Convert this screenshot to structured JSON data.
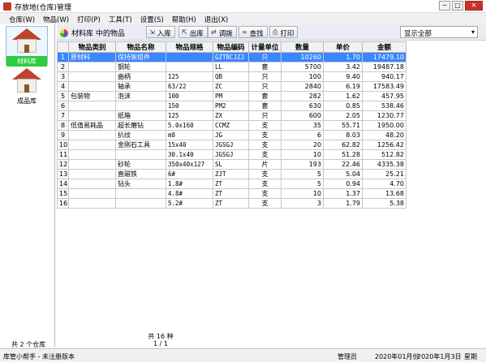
{
  "window": {
    "title": "存放地(仓库)管理",
    "controls": [
      "─",
      "□",
      "✕"
    ]
  },
  "menu": [
    "仓库(W)",
    "物品(W)",
    "打印(P)",
    "工具(T)",
    "设置(S)",
    "帮助(H)",
    "退出(X)"
  ],
  "sidebar": {
    "items": [
      {
        "label": "材料库",
        "active": true
      },
      {
        "label": "成品库",
        "active": false
      }
    ],
    "count_text": "共 2 个仓库"
  },
  "toolbar": {
    "title": "材料库 中的物品",
    "buttons": [
      {
        "label": "入库",
        "icon": "import-icon"
      },
      {
        "label": "出库",
        "icon": "export-icon"
      },
      {
        "label": "调拨",
        "icon": "transfer-icon"
      },
      {
        "label": "查找",
        "icon": "binoculars-icon"
      },
      {
        "label": "打印",
        "icon": "printer-icon"
      }
    ],
    "filter_value": "显示全部"
  },
  "table": {
    "columns": [
      "",
      "物品类别",
      "物品名称",
      "物品规格",
      "物品编码",
      "计量单位",
      "数量",
      "单价",
      "金额"
    ],
    "rows": [
      [
        "1",
        "原材料",
        "保持架组件",
        "",
        "GZTBCJZJ",
        "只",
        "10260",
        "1.70",
        "17479.10"
      ],
      [
        "2",
        "",
        "钢轮",
        "",
        "LL",
        "套",
        "5700",
        "3.42",
        "19487.18"
      ],
      [
        "3",
        "",
        "曲柄",
        "125",
        "QB",
        "只",
        "100",
        "9.40",
        "940.17"
      ],
      [
        "4",
        "",
        "轴承",
        "63/22",
        "ZC",
        "只",
        "2840",
        "6.19",
        "17583.49"
      ],
      [
        "5",
        "包装物",
        "泡沫",
        "100",
        "PM",
        "套",
        "282",
        "1.62",
        "457.95"
      ],
      [
        "6",
        "",
        "",
        "150",
        "PM2",
        "套",
        "630",
        "0.85",
        "538.46"
      ],
      [
        "7",
        "",
        "纸箱",
        "125",
        "ZX",
        "只",
        "600",
        "2.05",
        "1230.77"
      ],
      [
        "8",
        "低值易耗品",
        "超长磨钻",
        "5.0x160",
        "CCMZ",
        "支",
        "35",
        "55.71",
        "1950.00"
      ],
      [
        "9",
        "",
        "扒纹",
        "m8",
        "JG",
        "支",
        "6",
        "8.03",
        "48.20"
      ],
      [
        "10",
        "",
        "金刚石工具",
        "15x40",
        "JGSGJ",
        "支",
        "20",
        "62.82",
        "1256.42"
      ],
      [
        "11",
        "",
        "",
        "30.1x40",
        "JGSGJ",
        "支",
        "10",
        "51.28",
        "512.82"
      ],
      [
        "12",
        "",
        "砂轮",
        "350x40x127",
        "SL",
        "片",
        "193",
        "22.46",
        "4335.38"
      ],
      [
        "13",
        "",
        "直磁铁",
        "6#",
        "ZJT",
        "支",
        "5",
        "5.04",
        "25.21"
      ],
      [
        "14",
        "",
        "钻头",
        "1.8#",
        "ZT",
        "支",
        "5",
        "0.94",
        "4.70"
      ],
      [
        "15",
        "",
        "",
        "4.8#",
        "ZT",
        "支",
        "10",
        "1.37",
        "13.68"
      ],
      [
        "16",
        "",
        "",
        "5.2#",
        "ZT",
        "支",
        "3",
        "1.79",
        "5.38"
      ]
    ]
  },
  "footer": {
    "total": "共 16 种",
    "page": "1 / 1"
  },
  "status": {
    "app": "库管小帮手 - 未注册版本",
    "user": "管理员",
    "period": "2020年01月份",
    "date": "2020年1月3日",
    "weekday": "星期"
  }
}
